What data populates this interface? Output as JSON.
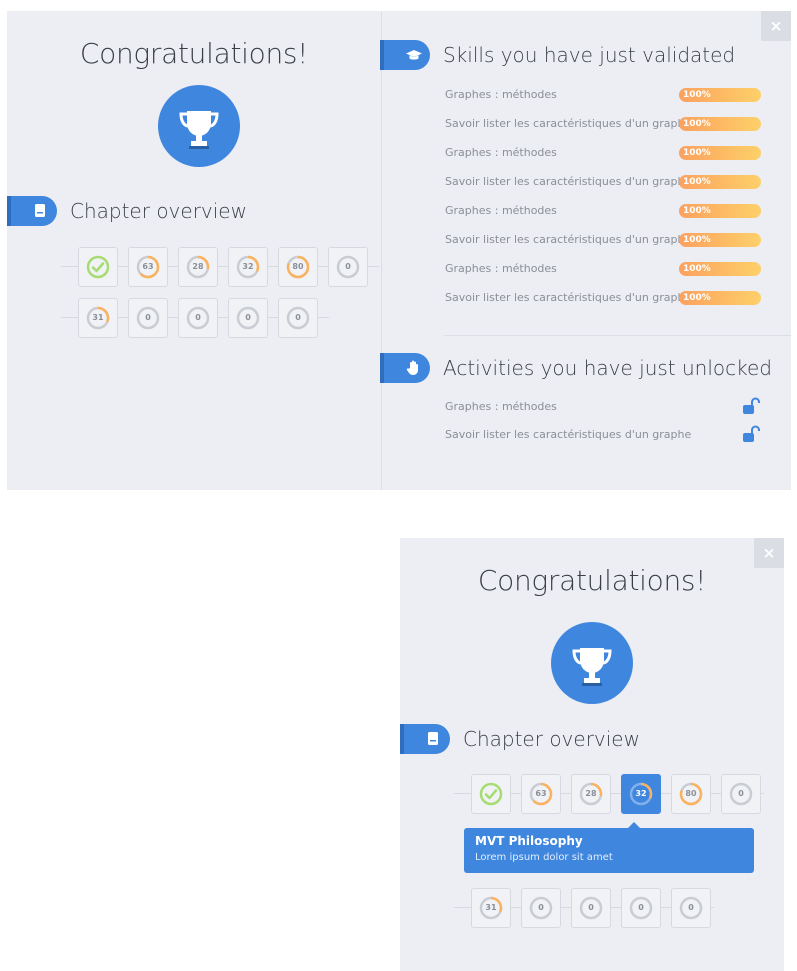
{
  "close_symbol": "×",
  "modal_large": {
    "title": "Congratulations!",
    "chapter_overview_label": "Chapter overview",
    "skills_label": "Skills you have just validated",
    "activities_label": "Activities you have just unlocked",
    "chapter_cells_row1": [
      {
        "type": "check",
        "value": ""
      },
      {
        "type": "progress",
        "value": "63"
      },
      {
        "type": "progress",
        "value": "28"
      },
      {
        "type": "progress",
        "value": "32"
      },
      {
        "type": "progress",
        "value": "80"
      },
      {
        "type": "empty",
        "value": "0"
      }
    ],
    "chapter_cells_row2": [
      {
        "type": "progress",
        "value": "31"
      },
      {
        "type": "empty",
        "value": "0"
      },
      {
        "type": "empty",
        "value": "0"
      },
      {
        "type": "empty",
        "value": "0"
      },
      {
        "type": "empty",
        "value": "0"
      }
    ],
    "skills": [
      {
        "name": "Graphes : méthodes",
        "percent_label": "100%",
        "progress": 1.0
      },
      {
        "name": "Savoir lister les caractéristiques d'un graphe",
        "percent_label": "100%",
        "progress": 1.0
      },
      {
        "name": "Graphes : méthodes",
        "percent_label": "100%",
        "progress": 1.0
      },
      {
        "name": "Savoir lister les caractéristiques d'un graphe",
        "percent_label": "100%",
        "progress": 1.0
      },
      {
        "name": "Graphes : méthodes",
        "percent_label": "100%",
        "progress": 1.0
      },
      {
        "name": "Savoir lister les caractéristiques d'un graphe",
        "percent_label": "100%",
        "progress": 1.0
      },
      {
        "name": "Graphes : méthodes",
        "percent_label": "100%",
        "progress": 1.0
      },
      {
        "name": "Savoir lister les caractéristiques d'un graphe",
        "percent_label": "100%",
        "progress": 1.0
      }
    ],
    "activities": [
      {
        "name": "Graphes : méthodes",
        "icon": "unlock-icon"
      },
      {
        "name": "Savoir lister les caractéristiques d'un graphe",
        "icon": "unlock-icon"
      }
    ]
  },
  "modal_small": {
    "title": "Congratulations!",
    "chapter_overview_label": "Chapter overview",
    "chapter_cells_row1": [
      {
        "type": "check",
        "value": ""
      },
      {
        "type": "progress",
        "value": "63"
      },
      {
        "type": "progress",
        "value": "28"
      },
      {
        "type": "active",
        "value": "32"
      },
      {
        "type": "progress",
        "value": "80"
      },
      {
        "type": "empty",
        "value": "0"
      }
    ],
    "chapter_cells_row2": [
      {
        "type": "progress",
        "value": "31"
      },
      {
        "type": "empty",
        "value": "0"
      },
      {
        "type": "empty",
        "value": "0"
      },
      {
        "type": "empty",
        "value": "0"
      },
      {
        "type": "empty",
        "value": "0"
      }
    ],
    "tooltip": {
      "title": "MVT Philosophy",
      "body": "Lorem ipsum dolor sit amet"
    }
  },
  "colors": {
    "accent": "#3f86df",
    "panel_bg": "#eceef3",
    "check_green": "#a6dc72",
    "ring_orange": "#fbb25f",
    "ring_grey": "#c9ccd2"
  },
  "icons": {
    "close": "close-icon",
    "trophy": "trophy-icon",
    "book": "book-icon",
    "graduation": "graduation-cap-icon",
    "hand": "hand-icon",
    "check": "check-icon",
    "unlock": "unlock-icon"
  }
}
